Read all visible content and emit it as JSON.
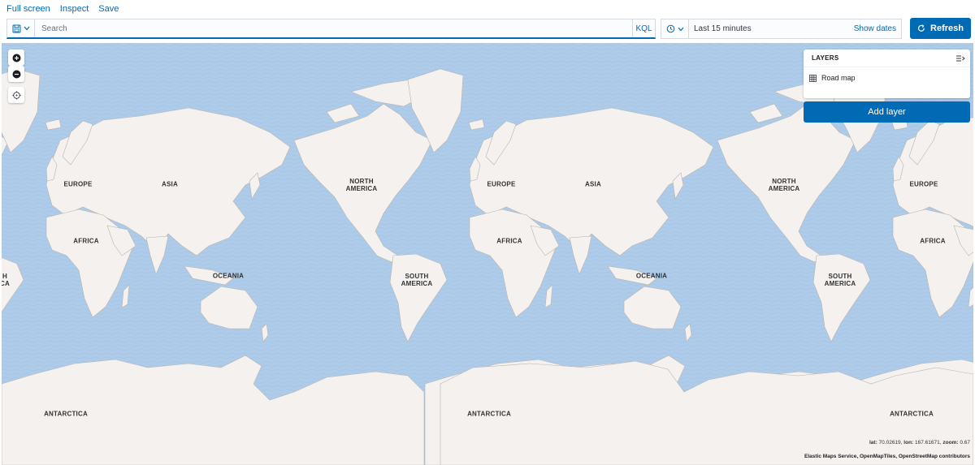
{
  "topnav": {
    "fullscreen": "Full screen",
    "inspect": "Inspect",
    "save": "Save"
  },
  "query": {
    "placeholder": "Search",
    "language": "KQL"
  },
  "time": {
    "label": "Last 15 minutes",
    "show_dates": "Show dates"
  },
  "refresh": {
    "label": "Refresh"
  },
  "layers": {
    "title": "LAYERS",
    "items": [
      {
        "label": "Road map"
      }
    ],
    "add_label": "Add layer"
  },
  "map": {
    "labels": {
      "europe": "EUROPE",
      "asia": "ASIA",
      "africa": "AFRICA",
      "oceania": "OCEANIA",
      "north_america": [
        "NORTH",
        "AMERICA"
      ],
      "south_america": [
        "SOUTH",
        "AMERICA"
      ],
      "antarctica": "ANTARCTICA",
      "cut_na": [
        "H",
        "CA"
      ]
    },
    "status": {
      "lat_label": "lat:",
      "lat": "70.02619",
      "lon_label": "lon:",
      "lon": "167.61671",
      "zoom_label": "zoom:",
      "zoom": "0.67"
    },
    "attribution": "Elastic Maps Service, OpenMapTiles, OpenStreetMap contributors"
  },
  "colors": {
    "accent": "#006bb4",
    "water": "#aecce9",
    "land": "#f4f1ee"
  }
}
